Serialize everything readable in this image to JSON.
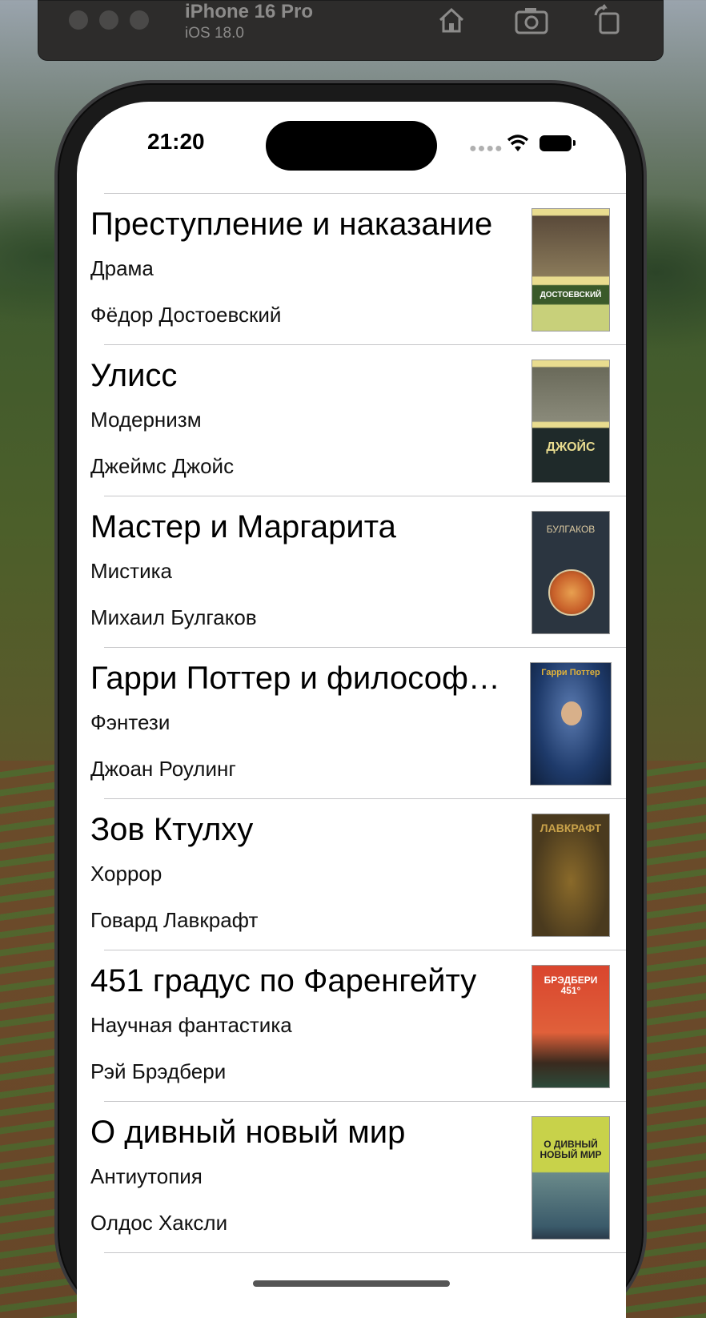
{
  "simulator": {
    "device_name": "iPhone 16 Pro",
    "os_version": "iOS 18.0",
    "icons": [
      "home-icon",
      "screenshot-icon",
      "rotate-icon"
    ]
  },
  "status_bar": {
    "time": "21:20",
    "icons": [
      "cellular-dots-icon",
      "wifi-icon",
      "battery-icon"
    ]
  },
  "books": [
    {
      "title": "Преступление и наказание",
      "genre": "Драма",
      "author": "Фёдор Достоевский",
      "cover": {
        "bg": "#e9dc8f",
        "accent": "#3a5a2a",
        "text": "ДОСТОЕВСКИЙ"
      }
    },
    {
      "title": "Улисс",
      "genre": "Модернизм",
      "author": "Джеймс Джойс",
      "cover": {
        "bg": "#e9dc8f",
        "accent": "#1f2a2a",
        "text": "ДЖОЙС"
      }
    },
    {
      "title": "Мастер и Маргарита",
      "genre": "Мистика",
      "author": "Михаил Булгаков",
      "cover": {
        "bg": "#2b3540",
        "accent": "#c8602a",
        "text": "БУЛГАКОВ"
      }
    },
    {
      "title": "Гарри Поттер и философский камень",
      "genre": "Фэнтези",
      "author": "Джоан Роулинг",
      "cover": {
        "bg": "#1e3a6a",
        "accent": "#e0b23a",
        "text": "Гарри Поттер"
      }
    },
    {
      "title": "Зов Ктулху",
      "genre": "Хоррор",
      "author": "Говард Лавкрафт",
      "cover": {
        "bg": "#4a3a1e",
        "accent": "#c9a24a",
        "text": "ЛАВКРАФТ"
      }
    },
    {
      "title": "451 градус по Фаренгейту",
      "genre": "Научная фантастика",
      "author": "Рэй Брэдбери",
      "cover": {
        "bg": "#d9452e",
        "accent": "#2c4a3a",
        "text": "БРЭДБЕРИ 451°"
      }
    },
    {
      "title": "О дивный новый мир",
      "genre": "Антиутопия",
      "author": "Олдос Хаксли",
      "cover": {
        "bg": "#c8d24a",
        "accent": "#3a5a6a",
        "text": "О ДИВНЫЙ НОВЫЙ МИР"
      }
    }
  ]
}
